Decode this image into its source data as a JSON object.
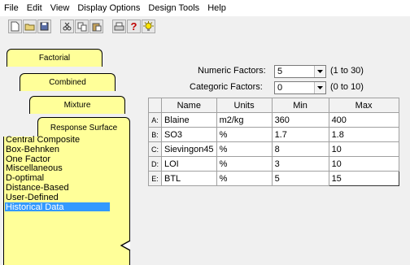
{
  "menu": [
    "File",
    "Edit",
    "View",
    "Display Options",
    "Design Tools",
    "Help"
  ],
  "toolbar_icons": [
    "new-file-icon",
    "open-folder-icon",
    "save-icon",
    "cut-icon",
    "copy-icon",
    "paste-icon",
    "print-icon",
    "help-icon",
    "tip-icon"
  ],
  "tabs": {
    "factorial": "Factorial",
    "combined": "Combined",
    "mixture": "Mixture",
    "response_surface": "Response Surface"
  },
  "designs": [
    "Central Composite",
    "Box-Behnken",
    "One Factor",
    "Miscellaneous",
    "D-optimal",
    "Distance-Based",
    "User-Defined",
    "Historical Data"
  ],
  "selected_design": "Historical Data",
  "numeric": {
    "label": "Numeric Factors:",
    "value": "5",
    "range": "(1 to 30)"
  },
  "categoric": {
    "label": "Categoric Factors:",
    "value": "0",
    "range": "(0 to 10)"
  },
  "grid": {
    "headers": [
      "Name",
      "Units",
      "Min",
      "Max"
    ],
    "rows": [
      {
        "id": "A:",
        "name": "Blaine",
        "units": "m2/kg",
        "min": "360",
        "max": "400"
      },
      {
        "id": "B:",
        "name": "SO3",
        "units": "%",
        "min": "1.7",
        "max": "1.8"
      },
      {
        "id": "C:",
        "name": "Sievingon45",
        "units": "%",
        "min": "8",
        "max": "10"
      },
      {
        "id": "D:",
        "name": "LOI",
        "units": "%",
        "min": "3",
        "max": "10"
      },
      {
        "id": "E:",
        "name": "BTL",
        "units": "%",
        "min": "5",
        "max": "15"
      }
    ]
  },
  "colors": {
    "tab_yellow": "#ffff99",
    "selection": "#3399ff"
  }
}
